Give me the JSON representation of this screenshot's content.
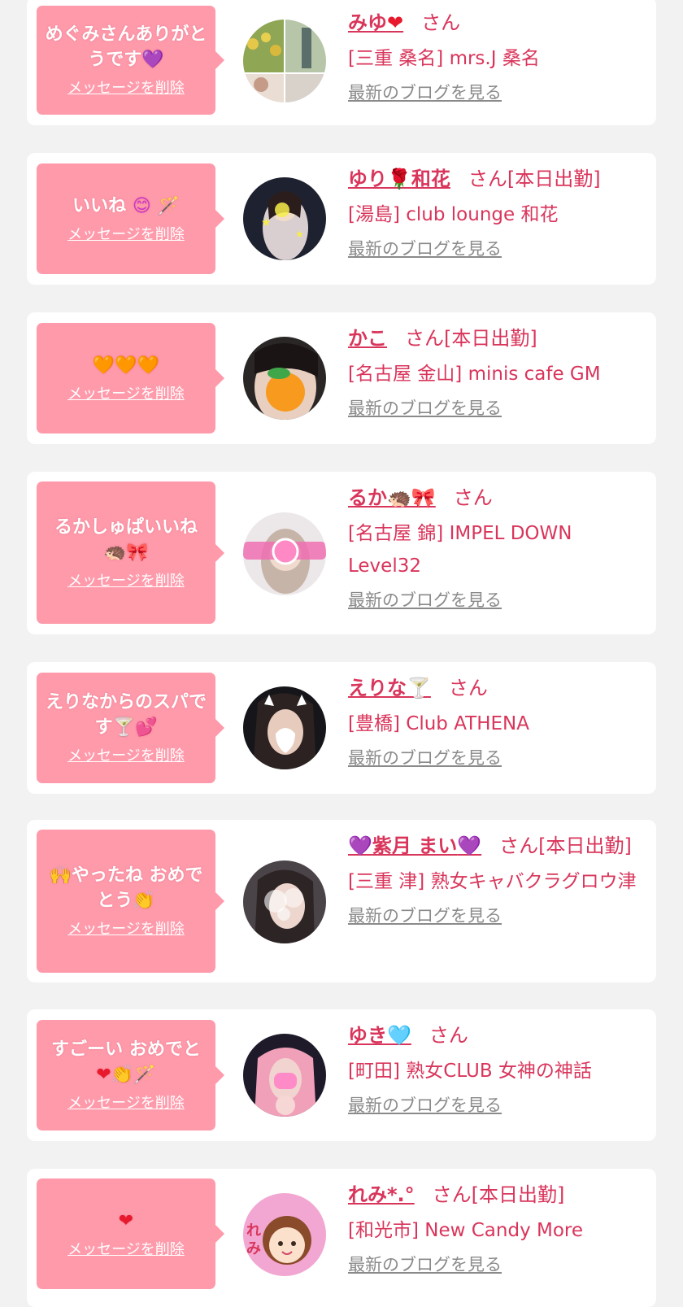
{
  "delete_label": "メッセージを削除",
  "blog_label": "最新のブログを見る",
  "san_label": "さん",
  "cards": [
    {
      "message": "めぐみさんありがとうです",
      "message_emoji": "💜",
      "name": "みゆ",
      "name_emoji": "❤",
      "status": "",
      "shop": "[三重 桑名] mrs.J 桑名"
    },
    {
      "message": "いいね",
      "message_emoji": "😊 🪄",
      "name": "ゆり",
      "name_emoji": "🌹",
      "name_suffix": "和花",
      "status": "[本日出勤]",
      "shop": "[湯島] club lounge 和花"
    },
    {
      "message": "",
      "message_emoji": "🧡🧡🧡",
      "name": "かこ",
      "name_emoji": "",
      "status": "[本日出勤]",
      "shop": "[名古屋 金山] minis cafe GM"
    },
    {
      "message": "るかしゅぱいいね",
      "message_emoji": "🦔🎀",
      "name": "るか",
      "name_emoji": "🦔🎀",
      "status": "",
      "shop": "[名古屋 錦] IMPEL DOWN Level32"
    },
    {
      "message": "えりなからのスパです",
      "message_emoji": "🍸💕",
      "name": "えりな",
      "name_emoji": "🍸",
      "status": "",
      "shop": "[豊橋] Club ATHENA"
    },
    {
      "message": "やったね おめでとう",
      "message_emoji": "🙌🎉👏",
      "name": "紫月 まい",
      "name_emoji": "💜",
      "status": "[本日出勤]",
      "shop": "[三重 津] 熟女キャバクラグロウ津"
    },
    {
      "message": "すごーい おめでと",
      "message_emoji": "❤👏🪄",
      "name": "ゆき",
      "name_emoji": "🩵",
      "status": "",
      "shop": "[町田] 熟女CLUB 女神の神話"
    },
    {
      "message": "",
      "message_emoji": "❤",
      "name": "れみ*.°",
      "name_emoji": "",
      "status": "[本日出勤]",
      "shop": "[和光市] New Candy More"
    }
  ]
}
